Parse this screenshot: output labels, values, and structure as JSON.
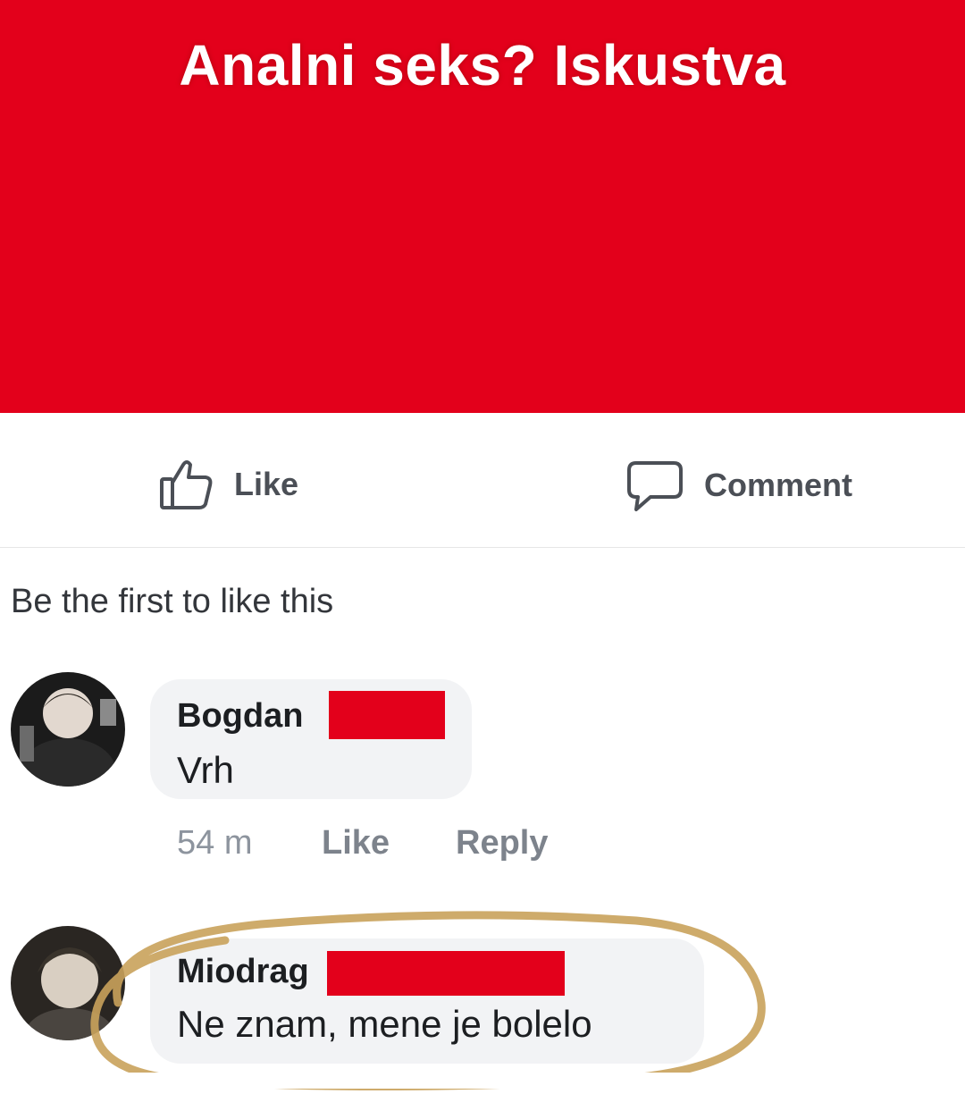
{
  "post": {
    "banner_title": "Analni seks? Iskustva",
    "banner_color": "#e3001b"
  },
  "actions": {
    "like_label": "Like",
    "comment_label": "Comment",
    "like_icon": "thumbs-up-icon",
    "comment_icon": "speech-bubble-icon"
  },
  "reactions": {
    "summary": "Be the first to like this"
  },
  "comments": [
    {
      "author": "Bogdan",
      "text": "Vrh",
      "time": "54 m",
      "like_label": "Like",
      "reply_label": "Reply"
    },
    {
      "author": "Miodrag",
      "text": "Ne znam, mene je bolelo"
    }
  ]
}
